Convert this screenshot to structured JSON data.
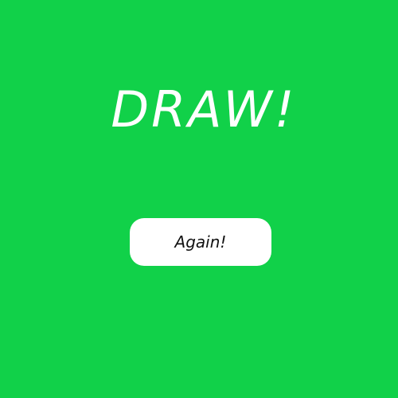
{
  "result": {
    "title": "DRAW!"
  },
  "actions": {
    "again_label": "Again!"
  },
  "colors": {
    "background": "#11d149",
    "title_text": "#ffffff",
    "button_background": "#ffffff",
    "button_text": "#111111"
  }
}
